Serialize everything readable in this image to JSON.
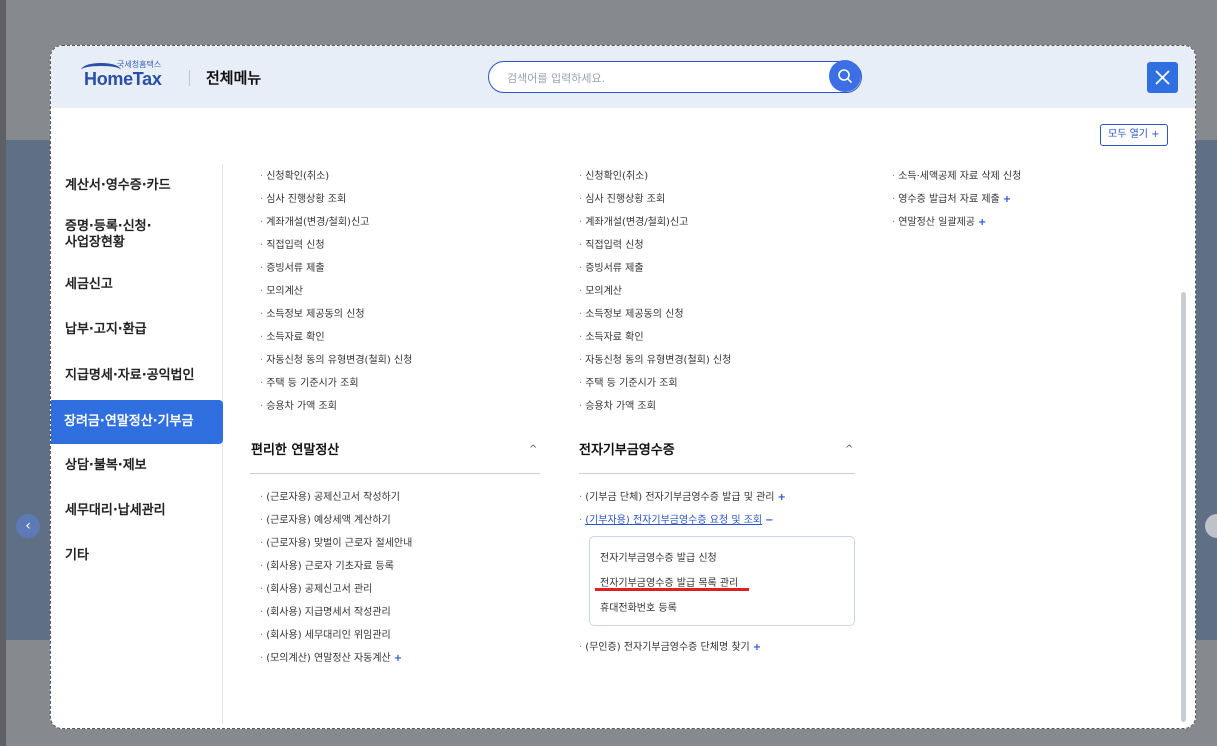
{
  "header": {
    "logo_small": "국세청홈택스",
    "logo_main": "HomeTax",
    "title": "전체메뉴",
    "search_placeholder": "검색어를 입력하세요."
  },
  "expand_all_label": "모두 열기 +",
  "nav": {
    "items": [
      {
        "label": "계산서·영수증·카드"
      },
      {
        "label": "증명·등록·신청·\n사업장현황"
      },
      {
        "label": "세금신고"
      },
      {
        "label": "납부·고지·환급"
      },
      {
        "label": "지급명세·자료·공익법인"
      },
      {
        "label": "장려금·연말정산·기부금"
      },
      {
        "label": "상담·불복·제보"
      },
      {
        "label": "세무대리·납세관리"
      },
      {
        "label": "기타"
      }
    ]
  },
  "col1": {
    "links": [
      "신청확인(취소)",
      "심사 진행상황 조회",
      "계좌개설(변경/철회)신고",
      "직접입력 신청",
      "증빙서류 제출",
      "모의계산",
      "소득정보 제공동의 신청",
      "소득자료 확인",
      "자동신청 동의 유형변경(철회) 신청",
      "주택 등 기준시가 조회",
      "승용차 가액 조회"
    ],
    "section_title": "편리한 연말정산",
    "section_links": [
      "(근로자용) 공제신고서 작성하기",
      "(근로자용) 예상세액 계산하기",
      "(근로자용) 맞벌이 근로자 절세안내",
      "(회사용) 근로자 기초자료 등록",
      "(회사용) 공제신고서 관리",
      "(회사용) 지급명세서 작성관리",
      "(회사용) 세무대리인 위임관리",
      "(모의계산) 연말정산 자동계산"
    ]
  },
  "col2": {
    "links": [
      "신청확인(취소)",
      "심사 진행상황 조회",
      "계좌개설(변경/철회)신고",
      "직접입력 신청",
      "증빙서류 제출",
      "모의계산",
      "소득정보 제공동의 신청",
      "소득자료 확인",
      "자동신청 동의 유형변경(철회) 신청",
      "주택 등 기준시가 조회",
      "승용차 가액 조회"
    ],
    "section_title": "전자기부금영수증",
    "section_link_1": "(기부금 단체) 전자기부금영수증 발급 및 관리",
    "section_link_2": "(기부자용) 전자기부금영수증 요청 및 조회",
    "submenu": [
      "전자기부금영수증 발급 신청",
      "전자기부금영수증 발급 목록 관리",
      "휴대전화번호 등록"
    ],
    "section_link_3": "(무인증) 전자기부금영수증 단체명 찾기"
  },
  "col3": {
    "links": [
      "소득·세액공제 자료 삭제 신청",
      "영수증 발급처 자료 제출",
      "연말정산 일괄제공"
    ]
  },
  "symbols": {
    "dot": "·",
    "plus": "+",
    "minus": "−",
    "caret_up": "^",
    "prev": "‹"
  },
  "colors": {
    "accent": "#2f6fe0",
    "highlight_underline": "#e02020"
  }
}
